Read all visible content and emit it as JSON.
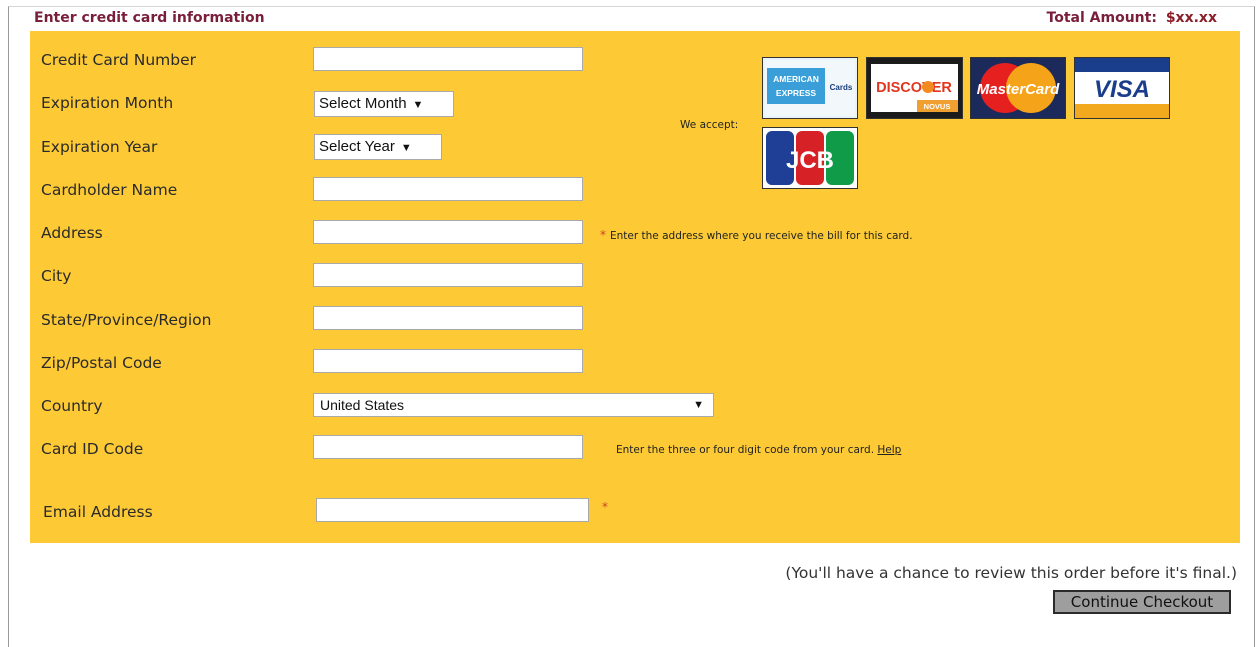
{
  "header": {
    "title": "Enter credit card information",
    "total_label": "Total Amount:",
    "total_value": "$xx.xx"
  },
  "form": {
    "card_number_label": "Credit Card Number",
    "exp_month_label": "Expiration Month",
    "exp_month_value": "Select Month",
    "exp_year_label": "Expiration Year",
    "exp_year_value": "Select Year",
    "cardholder_label": "Cardholder Name",
    "address_label": "Address",
    "address_hint": "Enter the address where you receive the bill for this card.",
    "city_label": "City",
    "state_label": "State/Province/Region",
    "zip_label": "Zip/Postal Code",
    "country_label": "Country",
    "country_value": "United States",
    "card_id_label": "Card ID Code",
    "card_id_hint": "Enter the three or four digit code from your card.",
    "help_link": "Help",
    "email_label": "Email Address",
    "required_marker": "*"
  },
  "accept": {
    "label": "We accept:",
    "cards": [
      {
        "name": "American Express",
        "text_a": "AMERICAN",
        "text_b": "EXPRESS",
        "text_c": "Cards"
      },
      {
        "name": "Discover",
        "text": "DISCOVER",
        "sub": "NOVUS"
      },
      {
        "name": "MasterCard",
        "text": "MasterCard"
      },
      {
        "name": "Visa",
        "text": "VISA"
      },
      {
        "name": "JCB",
        "text": "JCB"
      }
    ]
  },
  "footer": {
    "review_note": "(You'll have a chance to review this order before it's final.)",
    "continue_button": "Continue Checkout"
  },
  "colors": {
    "panel": "#fdca35",
    "title": "#7a1f3b",
    "required": "#d1402a"
  }
}
